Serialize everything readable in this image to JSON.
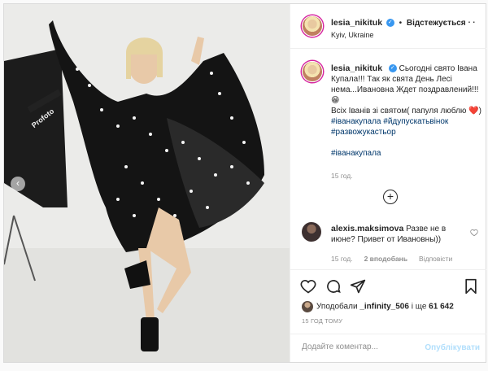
{
  "post": {
    "username": "lesia_nikituk",
    "follow_label": "Відстежується",
    "location": "Kyiv, Ukraine",
    "caption_lines": {
      "line1": "Сьогодні свято Івана Купала!!! Так як свята День Лесі нема...Ивановна Ждет поздравлений!!!",
      "line2_prefix": "Всіх Іванів зі святом( папуля люблю",
      "line2_mid": ")",
      "tag1": "#іванакупала",
      "tag2": "#йдупускатьвінок",
      "tag3": "#развожукастьор",
      "tag4": "#іванакупала"
    },
    "caption_time": "15 год.",
    "comment": {
      "username": "alexis.maksimova",
      "text": "Разве не в июне? Привет от Ивановны))",
      "time": "15 год.",
      "likes": "2 вподобань",
      "reply": "Відповісти"
    },
    "likes_prefix": "Уподобали",
    "likes_user": "_infinity_506",
    "likes_suffix": "і ще",
    "likes_count": "61 642",
    "post_time": "15 ГОД ТОМУ",
    "add_comment_placeholder": "Додайте коментар...",
    "publish_label": "Опублікувати",
    "photo_brand_text": "Profoto"
  },
  "icons": [
    "more-icon",
    "verified-icon",
    "heart-icon",
    "comment-icon",
    "share-icon",
    "bookmark-icon",
    "plus-circle-icon",
    "carousel-left-icon"
  ],
  "colors": {
    "link": "#00376b",
    "muted": "#8e8e8e",
    "verified": "#3897f0",
    "publish": "#b2dffc",
    "heart_emoji": "#e0245e"
  }
}
